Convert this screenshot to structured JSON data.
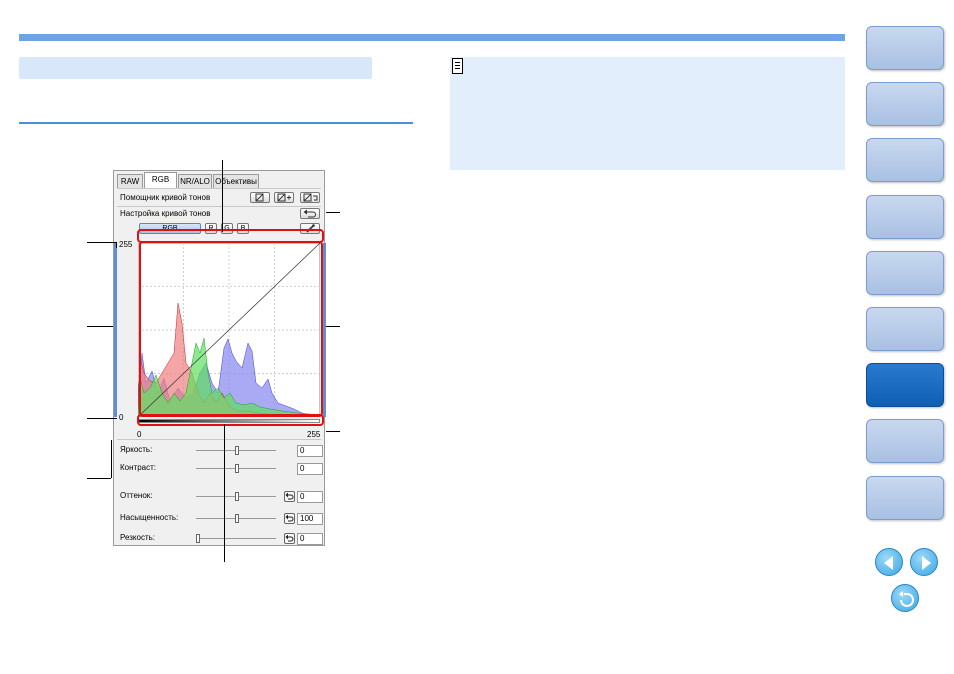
{
  "panel": {
    "tabs": [
      "RAW",
      "RGB",
      "NR/ALO",
      "Объективы"
    ],
    "active_tab": "RGB",
    "tone_curve_assist_label": "Помощник кривой тонов",
    "tone_curve_adjust_label": "Настройка кривой тонов",
    "channel_buttons": [
      "RGB",
      "R",
      "G",
      "B"
    ],
    "graph": {
      "y_max_label": "255",
      "y_min_label": "0",
      "x_min_label": "0",
      "x_max_label": "255"
    },
    "sliders": [
      {
        "label": "Яркость:",
        "value": "0",
        "thumb_fraction": 0.5,
        "has_reset": false
      },
      {
        "label": "Контраст:",
        "value": "0",
        "thumb_fraction": 0.5,
        "has_reset": false
      },
      {
        "label": "Оттенок:",
        "value": "0",
        "thumb_fraction": 0.5,
        "has_reset": true
      },
      {
        "label": "Насыщенность:",
        "value": "100",
        "thumb_fraction": 0.5,
        "has_reset": true
      },
      {
        "label": "Резкость:",
        "value": "0",
        "thumb_fraction": 0.0,
        "has_reset": true
      }
    ]
  },
  "colors": {
    "accent": "#6fa3e6",
    "nav_active": "#0e5fb3",
    "callout_box": "#e01010",
    "histogram_red": "#f08080",
    "histogram_green": "#60e060",
    "histogram_blue": "#8c8cf0"
  },
  "navigation": {
    "tab_count": 9,
    "active_index": 6,
    "prev_icon": "left-arrow-icon",
    "next_icon": "right-arrow-icon",
    "return_icon": "return-icon"
  },
  "note_icon": "memo-icon"
}
